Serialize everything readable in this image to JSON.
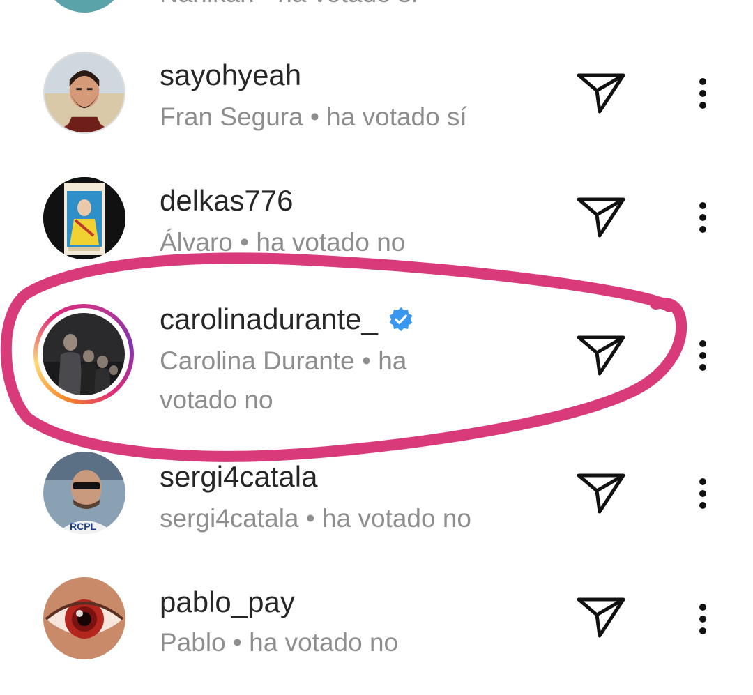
{
  "partial_row": {
    "subtitle": "Nahikari • ha votado sí"
  },
  "rows": [
    {
      "username": "sayohyeah",
      "subtitle": "Fran Segura • ha votado sí",
      "avatar": "bearded-man-avatar"
    },
    {
      "username": "delkas776",
      "subtitle": "Álvaro • ha votado no",
      "avatar": "queen-poster-avatar"
    },
    {
      "username": "carolinadurante_",
      "subtitle_line1": "Carolina Durante • ha",
      "subtitle_line2": "votado no",
      "verified": true,
      "avatar": "band-photo-avatar",
      "story_ring": true
    },
    {
      "username": "sergi4catala",
      "subtitle": "sergi4catala • ha votado no",
      "avatar": "sunglasses-man-avatar"
    },
    {
      "username": "pablo_pay",
      "subtitle": "Pablo • ha votado no",
      "avatar": "red-eye-avatar"
    }
  ],
  "icons": {
    "send": "send-icon",
    "more": "more-options-icon",
    "verified": "verified-badge-icon"
  },
  "colors": {
    "annotation": "#d93a7a",
    "verified": "#3897f0",
    "username": "#262626",
    "subtitle": "#8e8e8e"
  }
}
